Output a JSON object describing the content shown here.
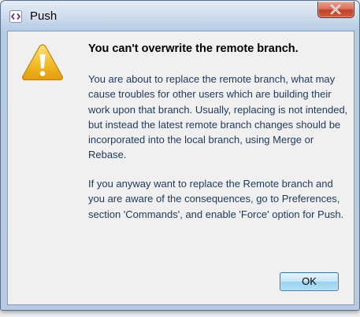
{
  "window": {
    "title": "Push",
    "close_label": "Close"
  },
  "dialog": {
    "icon": "warning-icon",
    "heading": "You can't overwrite the remote branch.",
    "paragraphs": [
      "You are about to replace the remote branch, what may cause troubles for other users which are building their work upon that branch. Usually, replacing is not intended, but instead the latest remote branch changes should be incorporated into the local branch, using Merge or Rebase.",
      "If you anyway want to replace the Remote branch and you are aware of the consequences, go to Preferences, section 'Commands', and enable 'Force' option for Push."
    ],
    "ok_label": "OK"
  },
  "colors": {
    "message_text": "#1e395b",
    "dialog_background": "#f0f0f0",
    "warning_yellow": "#f2b724"
  }
}
